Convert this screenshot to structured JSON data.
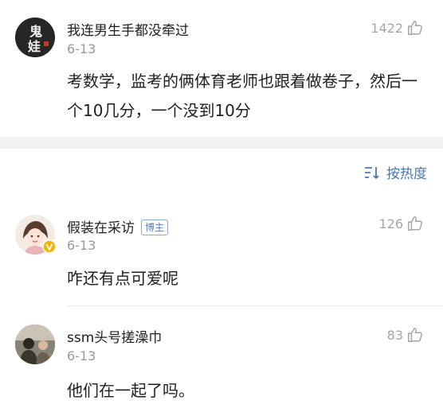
{
  "comments": [
    {
      "username": "我连男生手都没牵过",
      "date": "6-13",
      "likes": "1422",
      "text": "考数学，监考的俩体育老师也跟着做卷子，然后一个10几分，一个没到10分",
      "avatar_text": "鬼\n娃",
      "avatar_icon": "calligraphy-avatar-icon"
    },
    {
      "username": "假装在采访",
      "badge": "博主",
      "date": "6-13",
      "likes": "126",
      "text": "咋还有点可爱呢",
      "avatar_icon": "cartoon-girl-avatar-icon"
    },
    {
      "username": "ssm头号搓澡巾",
      "date": "6-13",
      "likes": "83",
      "text": "他们在一起了吗。",
      "avatar_icon": "photo-avatar-icon"
    }
  ],
  "sort": {
    "label": "按热度",
    "icon": "sort-icon"
  },
  "colors": {
    "link_blue": "#4d78b0",
    "muted_gray": "#999999",
    "separator_gray": "#f2f2f2",
    "verified_yellow": "#f5b400"
  }
}
